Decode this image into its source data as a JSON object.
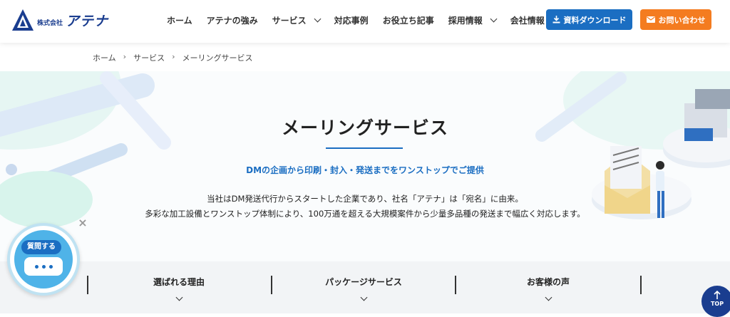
{
  "header": {
    "logo_small": "株式会社",
    "logo_big": "アテナ",
    "nav": [
      {
        "label": "ホーム",
        "has_dropdown": false
      },
      {
        "label": "アテナの強み",
        "has_dropdown": false
      },
      {
        "label": "サービス",
        "has_dropdown": true
      },
      {
        "label": "対応事例",
        "has_dropdown": false
      },
      {
        "label": "お役立ち記事",
        "has_dropdown": false
      },
      {
        "label": "採用情報",
        "has_dropdown": true
      },
      {
        "label": "会社情報",
        "has_dropdown": true
      }
    ],
    "download_label": "資料ダウンロード",
    "contact_label": "お問い合わせ"
  },
  "breadcrumb": [
    "ホーム",
    "サービス",
    "メーリングサービス"
  ],
  "hero": {
    "title": "メーリングサービス",
    "subtitle": "DMの企画から印刷・封入・発送までをワンストップでご提供",
    "desc_line1": "当社はDM発送代行からスタートした企業であり、社名「アテナ」は「宛名」に由来。",
    "desc_line2": "多彩な加工設備とワンストップ体制により、100万通を超える大規模案件から少量多品種の発送まで幅広く対応します。"
  },
  "tabs": [
    {
      "label": "選ばれる理由"
    },
    {
      "label": "パッケージサービス"
    },
    {
      "label": "お客様の声"
    }
  ],
  "chat": {
    "label": "質問する"
  },
  "top_button": {
    "label": "TOP"
  },
  "colors": {
    "brand_blue": "#1b6ec2",
    "navy": "#1a3d8f",
    "orange": "#f47c20"
  }
}
